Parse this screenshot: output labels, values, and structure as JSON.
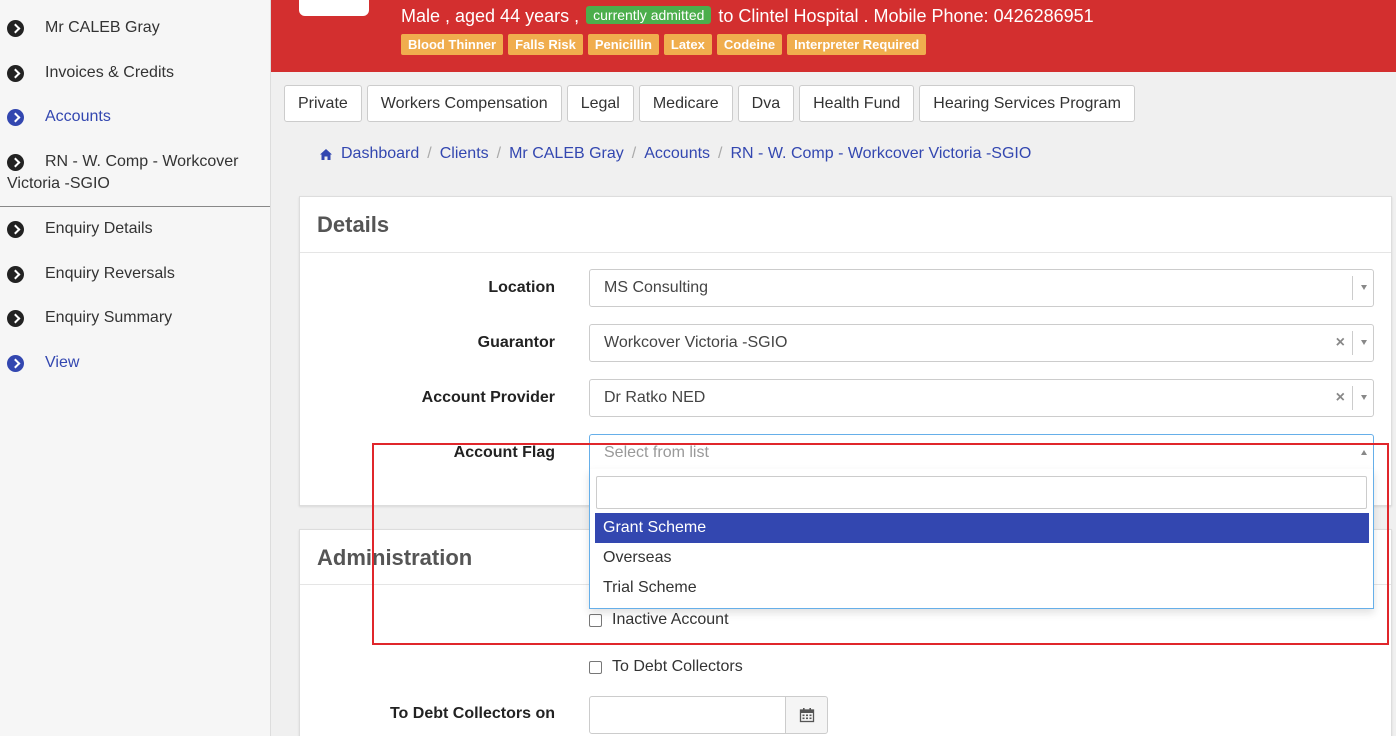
{
  "sidebar": {
    "items": [
      {
        "label": "Mr CALEB Gray",
        "active": false
      },
      {
        "label": "Invoices & Credits",
        "active": false
      },
      {
        "label": "Accounts",
        "active": true
      },
      {
        "label": "RN - W. Comp - Workcover Victoria -SGIO",
        "active": false
      },
      {
        "label": "Enquiry Details",
        "active": false
      },
      {
        "label": "Enquiry Reversals",
        "active": false
      },
      {
        "label": "Enquiry Summary",
        "active": false
      },
      {
        "label": "View",
        "active": true
      }
    ]
  },
  "header": {
    "line_prefix": "Male , aged 44 years ,",
    "admit_badge": "currently admitted",
    "line_suffix": "to Clintel Hospital . Mobile Phone: 0426286951",
    "alerts": [
      "Blood Thinner",
      "Falls Risk",
      "Penicillin",
      "Latex",
      "Codeine",
      "Interpreter Required"
    ],
    "bg_color": "#d32f2f",
    "alert_color": "#f0ad4e"
  },
  "tabs": [
    "Private",
    "Workers Compensation",
    "Legal",
    "Medicare",
    "Dva",
    "Health Fund",
    "Hearing Services Program"
  ],
  "breadcrumb": [
    "Dashboard",
    "Clients",
    "Mr CALEB Gray",
    "Accounts",
    "RN - W. Comp - Workcover Victoria -SGIO"
  ],
  "details": {
    "title": "Details",
    "location_label": "Location",
    "location_value": "MS Consulting",
    "guarantor_label": "Guarantor",
    "guarantor_value": "Workcover Victoria -SGIO",
    "provider_label": "Account Provider",
    "provider_value": "Dr Ratko NED",
    "flag_label": "Account Flag",
    "flag_placeholder": "Select from list",
    "flag_search_value": "",
    "flag_options": [
      "Grant Scheme",
      "Overseas",
      "Trial Scheme"
    ],
    "flag_highlighted": "Grant Scheme"
  },
  "administration": {
    "title": "Administration",
    "inactive_label": "Inactive Account",
    "debt_label": "To Debt Collectors",
    "debt_on_label": "To Debt Collectors on",
    "debt_on_value": ""
  },
  "colors": {
    "accent": "#3347b0",
    "annotation": "#e0262b"
  }
}
